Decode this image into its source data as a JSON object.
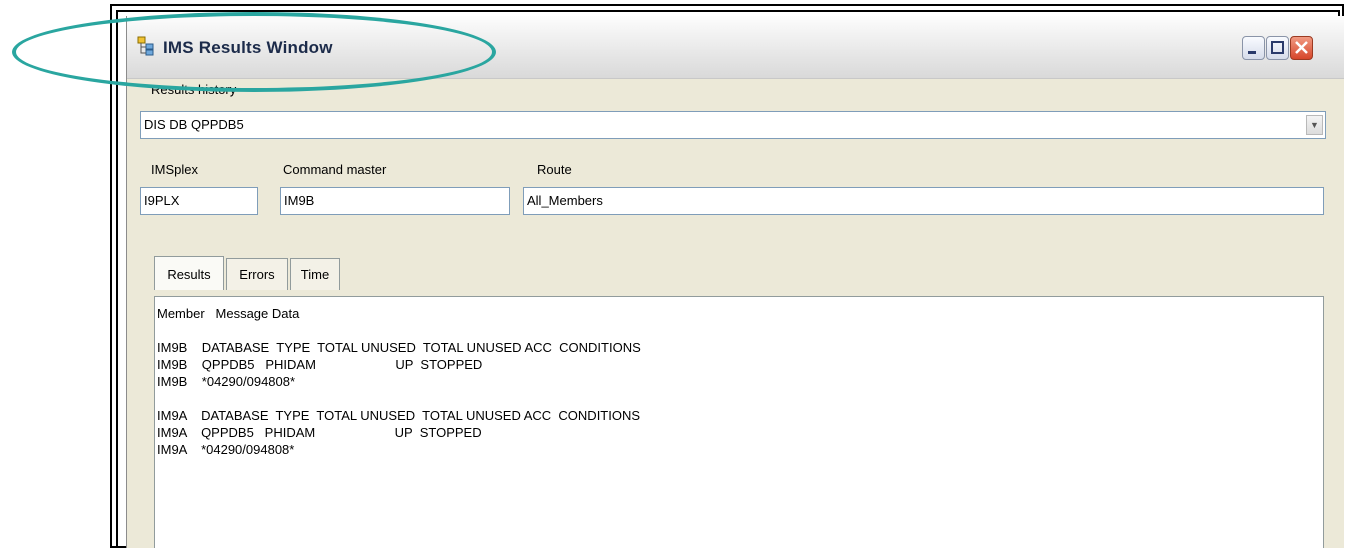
{
  "window": {
    "title": "IMS Results Window",
    "icon": "ims-tree-icon",
    "controls": {
      "minimize": "_",
      "maximize": "□",
      "close": "X"
    }
  },
  "results_history": {
    "label": "Results history",
    "value": "DIS DB QPPDB5"
  },
  "imsplex": {
    "label": "IMSplex",
    "value": "I9PLX"
  },
  "command_master": {
    "label": "Command master",
    "value": "IM9B"
  },
  "route": {
    "label": "Route",
    "value": "All_Members"
  },
  "tabs": [
    {
      "label": "Results",
      "active": true
    },
    {
      "label": "Errors",
      "active": false
    },
    {
      "label": "Time",
      "active": false
    }
  ],
  "results": {
    "header": "Member   Message Data",
    "lines": [
      "",
      "IM9B    DATABASE  TYPE  TOTAL UNUSED  TOTAL UNUSED ACC  CONDITIONS",
      "IM9B    QPPDB5   PHIDAM                      UP  STOPPED",
      "IM9B    *04290/094808*",
      "",
      "IM9A    DATABASE  TYPE  TOTAL UNUSED  TOTAL UNUSED ACC  CONDITIONS",
      "IM9A    QPPDB5   PHIDAM                      UP  STOPPED",
      "IM9A    *04290/094808*"
    ]
  },
  "colors": {
    "callout": "#2aa6a0",
    "close_button": "#d6462a"
  }
}
